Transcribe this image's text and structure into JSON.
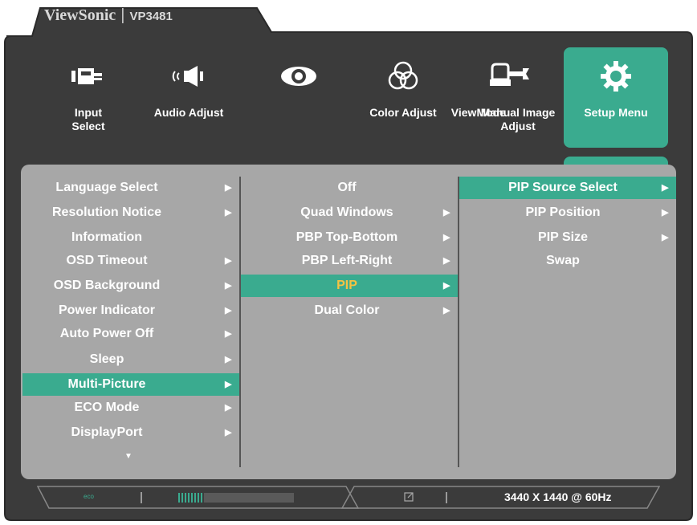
{
  "header": {
    "brand": "ViewSonic",
    "model": "VP3481"
  },
  "tabs": [
    {
      "label": "Input\nSelect",
      "icon": "input-select-icon"
    },
    {
      "label": "Audio Adjust",
      "icon": "speaker-icon"
    },
    {
      "label": "",
      "icon": "eye-icon"
    },
    {
      "label": "Color Adjust",
      "icon": "color-circles-icon"
    },
    {
      "label": "ViewMode",
      "icon": "hand-wrench-icon"
    },
    {
      "label": "Manual Image\nAdjust",
      "icon": "hand-wrench-icon"
    },
    {
      "label": "Setup Menu",
      "icon": "gear-icon"
    }
  ],
  "menu": {
    "col1": [
      {
        "label": "Language Select",
        "arrow": true
      },
      {
        "label": "Resolution Notice",
        "arrow": true
      },
      {
        "label": "Information",
        "arrow": false
      },
      {
        "label": "OSD Timeout",
        "arrow": true
      },
      {
        "label": "OSD Background",
        "arrow": true
      },
      {
        "label": "Power Indicator",
        "arrow": true
      },
      {
        "label": "Auto Power Off",
        "arrow": true
      },
      {
        "label": "Sleep",
        "arrow": true
      },
      {
        "label": "Multi-Picture",
        "arrow": true,
        "selected": true
      },
      {
        "label": "ECO Mode",
        "arrow": true
      },
      {
        "label": "DisplayPort",
        "arrow": true
      }
    ],
    "col2": [
      {
        "label": "Off",
        "arrow": false
      },
      {
        "label": "Quad Windows",
        "arrow": true
      },
      {
        "label": "PBP Top-Bottom",
        "arrow": true
      },
      {
        "label": "PBP Left-Right",
        "arrow": true
      },
      {
        "label": "PIP",
        "arrow": true,
        "selected": true
      },
      {
        "label": "Dual Color",
        "arrow": true
      }
    ],
    "col3": [
      {
        "label": "PIP Source Select",
        "arrow": true,
        "selected": true
      },
      {
        "label": "PIP Position",
        "arrow": true
      },
      {
        "label": "PIP Size",
        "arrow": true
      },
      {
        "label": "Swap",
        "arrow": false
      }
    ],
    "more_indicator": "▼"
  },
  "status_bar": {
    "eco_label": "eco",
    "resolution": "3440 X 1440 @ 60Hz"
  },
  "colors": {
    "accent": "#3aab8f",
    "panel": "#a7a7a7",
    "frame": "#3a3a3a",
    "highlight_text": "#f5c242"
  }
}
